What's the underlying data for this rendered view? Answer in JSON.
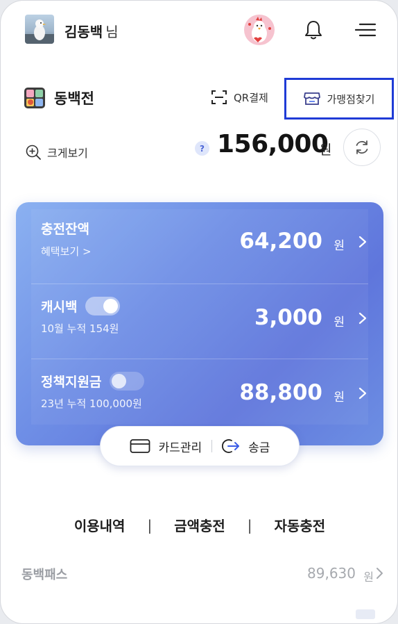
{
  "header": {
    "user_name": "김동백",
    "user_suffix": "님"
  },
  "wallet": {
    "name": "동백전",
    "qr_pay_label": "QR결제",
    "store_find_label": "가맹점찾기",
    "zoom_label": "크게보기",
    "help_mark": "?",
    "total_balance": "156,000",
    "total_unit": "원"
  },
  "card": {
    "rows": [
      {
        "label": "충전잔액",
        "sub": "혜택보기 >",
        "amount": "64,200",
        "unit": "원"
      },
      {
        "label": "캐시백",
        "toggle_on": true,
        "sub": "10월 누적 154원",
        "amount": "3,000",
        "unit": "원"
      },
      {
        "label": "정책지원금",
        "toggle_on": false,
        "sub": "23년 누적 100,000원",
        "amount": "88,800",
        "unit": "원"
      }
    ],
    "actions": {
      "card_manage": "카드관리",
      "transfer": "송금"
    }
  },
  "submenu": {
    "history": "이용내역",
    "charge": "금액충전",
    "auto_charge": "자동충전",
    "separator": "|"
  },
  "pass": {
    "name": "동백패스",
    "amount": "89,630",
    "unit": "원"
  },
  "colors": {
    "card_start": "#8bb1f1",
    "card_end": "#5f76dc",
    "highlight_box": "#1f3bd6",
    "accent_blue": "#4a64d6"
  }
}
